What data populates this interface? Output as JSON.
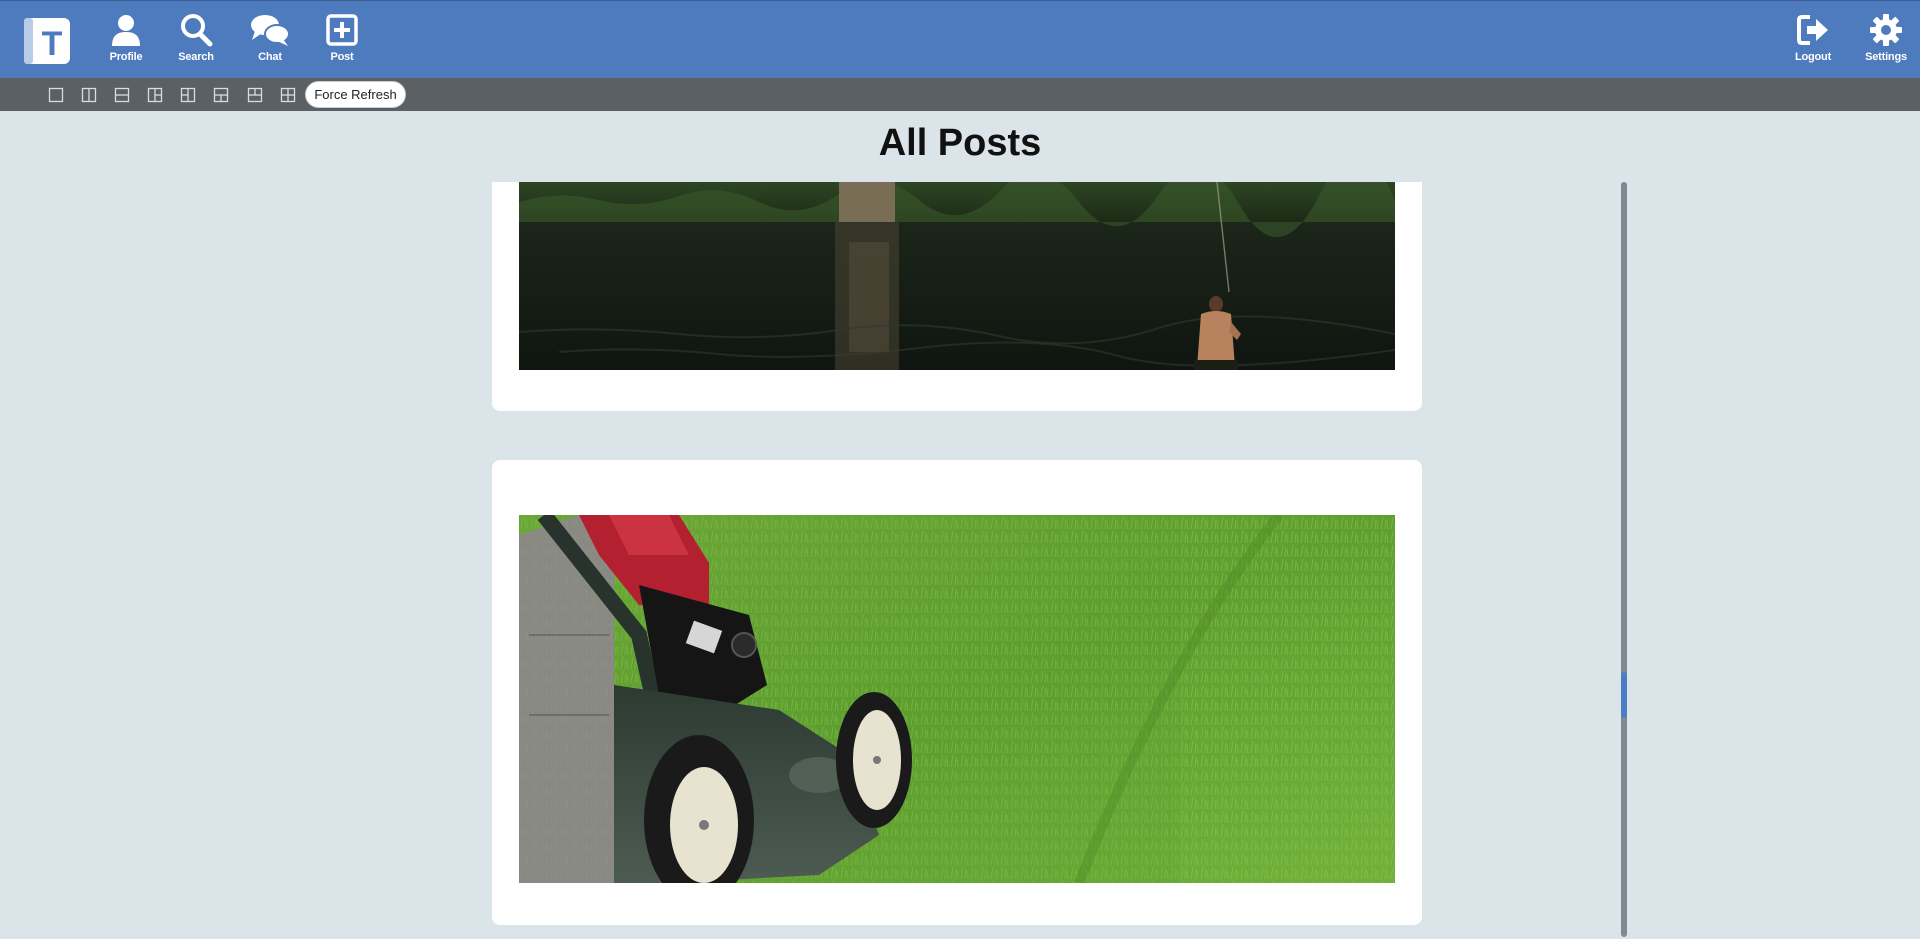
{
  "nav": {
    "items": [
      {
        "label": "Profile",
        "icon": "person-icon"
      },
      {
        "label": "Search",
        "icon": "search-icon"
      },
      {
        "label": "Chat",
        "icon": "chat-icon"
      },
      {
        "label": "Post",
        "icon": "plus-square-icon"
      }
    ],
    "right_items": [
      {
        "label": "Logout",
        "icon": "logout-icon"
      },
      {
        "label": "Settings",
        "icon": "gear-icon"
      }
    ],
    "logo_letter": "T"
  },
  "toolbar": {
    "layouts": [
      "single",
      "two-columns",
      "two-rows",
      "left-big-right-split",
      "right-big-left-split",
      "top-big-bottom-split",
      "bottom-big-top-split",
      "four-grid"
    ],
    "refresh_label": "Force Refresh"
  },
  "page": {
    "title": "All Posts"
  },
  "posts": [
    {
      "image": "river-swimmer-photo"
    },
    {
      "image": "lawn-mower-photo"
    }
  ],
  "colors": {
    "nav_bg": "#4e7bbd",
    "toolbar_bg": "#5b6064",
    "page_bg": "#dbe4e8",
    "accent": "#4a7dc4"
  }
}
